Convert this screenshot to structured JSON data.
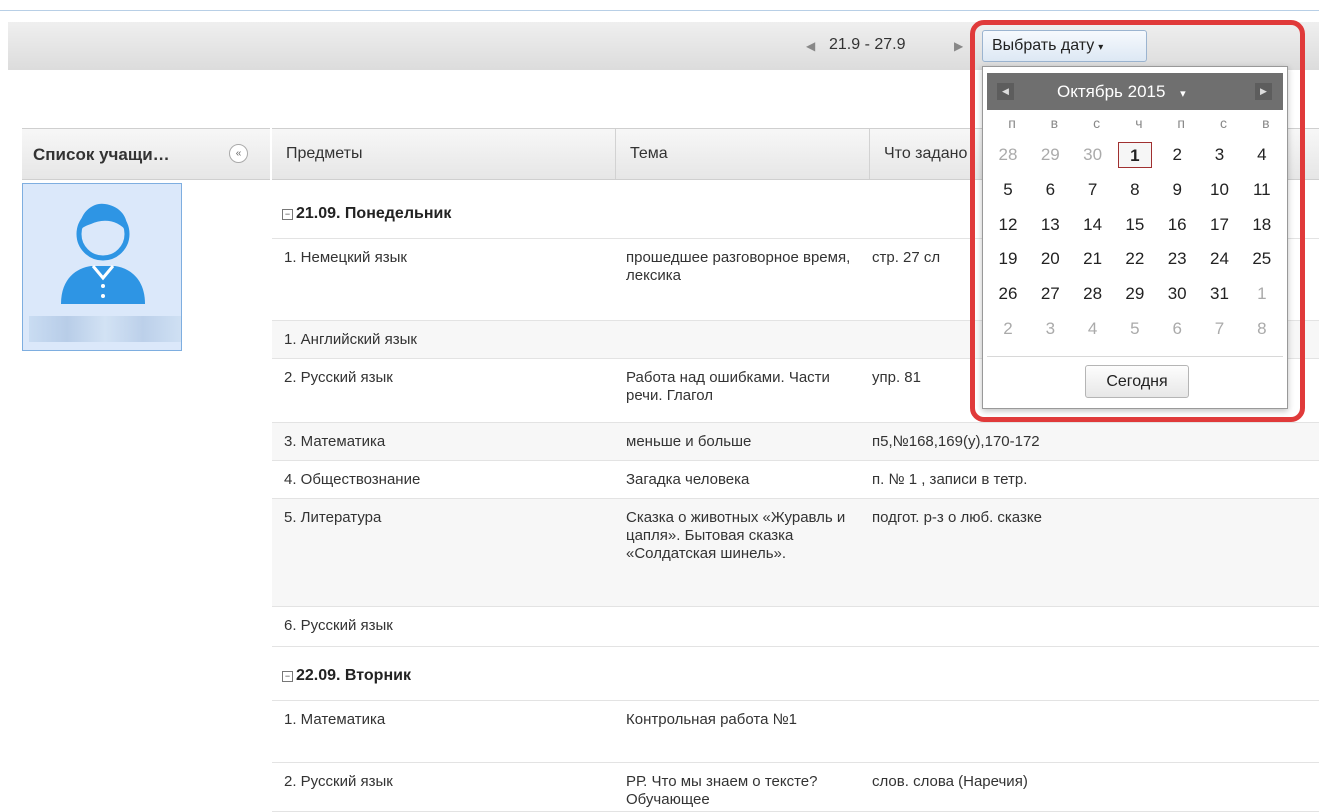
{
  "toolbar": {
    "week_range": "21.9 - 27.9",
    "select_date_label": "Выбрать дату"
  },
  "sidebar": {
    "title": "Список учащи…"
  },
  "grid": {
    "columns": [
      "Предметы",
      "Тема",
      "Что задано"
    ],
    "days": [
      {
        "label": "21.09. Понедельник",
        "rows": [
          {
            "subject": "1. Немецкий язык",
            "topic": "прошедшее разговорное время, лексика",
            "homework": "стр. 27 сл"
          },
          {
            "subject": "1. Английский язык",
            "topic": "",
            "homework": ""
          },
          {
            "subject": "2. Русский язык",
            "topic": "Работа над ошибками. Части речи. Глагол",
            "homework": "упр. 81"
          },
          {
            "subject": "3. Математика",
            "topic": "меньше и больше",
            "homework": "п5,№168,169(у),170-172"
          },
          {
            "subject": "4. Обществознание",
            "topic": "Загадка человека",
            "homework": "п. № 1 , записи в тетр."
          },
          {
            "subject": "5. Литература",
            "topic": "Сказка о животных «Журавль и цапля». Бытовая сказка «Солдатская шинель».",
            "homework": "подгот. р-з о люб. сказке"
          },
          {
            "subject": "6. Русский язык",
            "topic": "",
            "homework": ""
          }
        ]
      },
      {
        "label": "22.09. Вторник",
        "rows": [
          {
            "subject": "1. Математика",
            "topic": "Контрольная работа №1",
            "homework": ""
          },
          {
            "subject": "2. Русский язык",
            "topic": "РР. Что мы знаем о тексте? Обучающее",
            "homework": "слов. слова (Наречия)"
          }
        ]
      }
    ]
  },
  "datepicker": {
    "month_label": "Октябрь 2015",
    "weekdays": [
      "п",
      "в",
      "с",
      "ч",
      "п",
      "с",
      "в"
    ],
    "weeks": [
      [
        {
          "d": "28",
          "m": true
        },
        {
          "d": "29",
          "m": true
        },
        {
          "d": "30",
          "m": true
        },
        {
          "d": "1",
          "sel": true
        },
        {
          "d": "2"
        },
        {
          "d": "3"
        },
        {
          "d": "4"
        }
      ],
      [
        {
          "d": "5"
        },
        {
          "d": "6"
        },
        {
          "d": "7"
        },
        {
          "d": "8"
        },
        {
          "d": "9"
        },
        {
          "d": "10"
        },
        {
          "d": "11"
        }
      ],
      [
        {
          "d": "12"
        },
        {
          "d": "13"
        },
        {
          "d": "14"
        },
        {
          "d": "15"
        },
        {
          "d": "16"
        },
        {
          "d": "17"
        },
        {
          "d": "18"
        }
      ],
      [
        {
          "d": "19"
        },
        {
          "d": "20"
        },
        {
          "d": "21"
        },
        {
          "d": "22"
        },
        {
          "d": "23"
        },
        {
          "d": "24"
        },
        {
          "d": "25"
        }
      ],
      [
        {
          "d": "26"
        },
        {
          "d": "27"
        },
        {
          "d": "28"
        },
        {
          "d": "29"
        },
        {
          "d": "30"
        },
        {
          "d": "31"
        },
        {
          "d": "1",
          "m": true
        }
      ],
      [
        {
          "d": "2",
          "m": true
        },
        {
          "d": "3",
          "m": true
        },
        {
          "d": "4",
          "m": true
        },
        {
          "d": "5",
          "m": true
        },
        {
          "d": "6",
          "m": true
        },
        {
          "d": "7",
          "m": true
        },
        {
          "d": "8",
          "m": true
        }
      ]
    ],
    "today_label": "Сегодня",
    "highlight_color": "#e03a3a"
  },
  "icons": {
    "prev": "◀",
    "next": "▶",
    "collapse": "«",
    "caret": "▾",
    "expander": "−"
  }
}
